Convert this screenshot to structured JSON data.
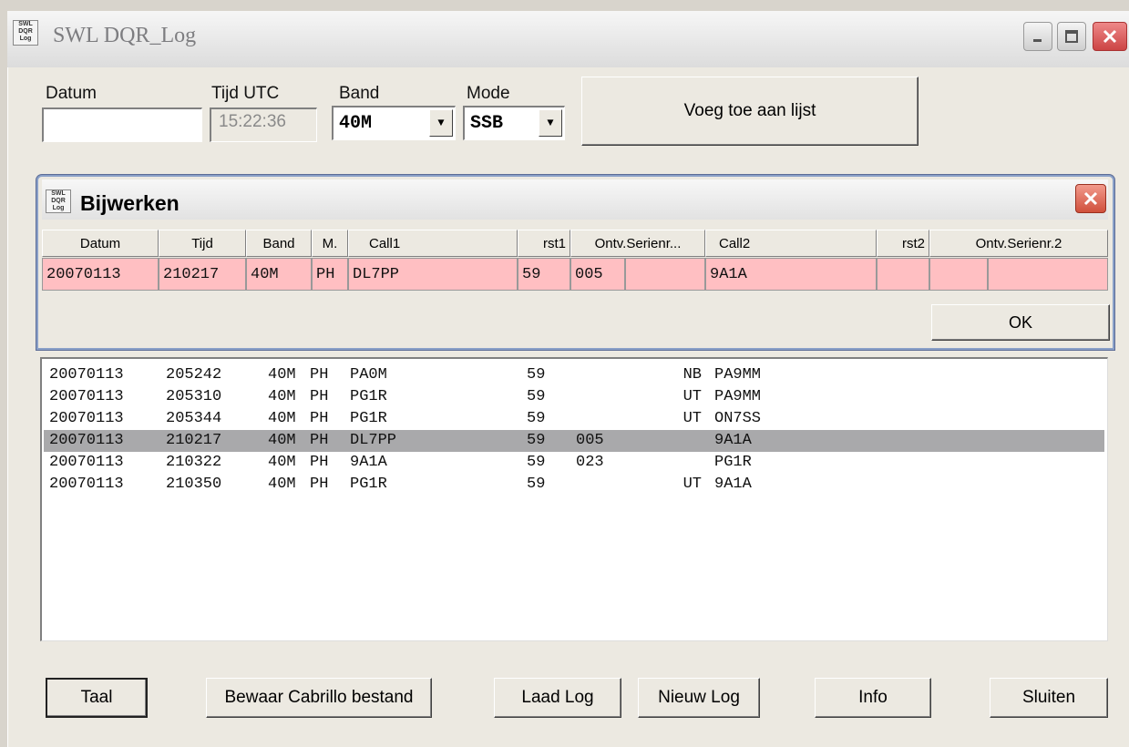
{
  "window": {
    "title": "SWL DQR_Log",
    "icon_text": "SWL DQR Log"
  },
  "form": {
    "datum_label": "Datum",
    "datum_value": "",
    "tijd_label": "Tijd UTC",
    "tijd_value": "15:22:36",
    "band_label": "Band",
    "band_value": "40M",
    "mode_label": "Mode",
    "mode_value": "SSB",
    "add_button": "Voeg toe aan lijst"
  },
  "dialog": {
    "title": "Bijwerken",
    "icon_text": "SWL DQR Log",
    "headers": [
      "Datum",
      "Tijd",
      "Band",
      "M.",
      "Call1",
      "rst1",
      "Ontv.Serienr...",
      "Call2",
      "rst2",
      "Ontv.Serienr.2"
    ],
    "row": {
      "datum": "20070113",
      "tijd": "210217",
      "band": "40M",
      "mode": "PH",
      "call1": "DL7PP",
      "rst1": "59",
      "serienr1": "005",
      "serienr1b": "",
      "call2": "9A1A",
      "rst2": "",
      "serienr2": "",
      "serienr2b": ""
    },
    "ok_button": "OK"
  },
  "log": [
    {
      "datum": "20070113",
      "tijd": "205242",
      "band": "40M",
      "mode": "PH",
      "call1": "PA0M",
      "rst": "59",
      "nr": "",
      "sect": "NB",
      "call2": "PA9MM",
      "selected": false
    },
    {
      "datum": "20070113",
      "tijd": "205310",
      "band": "40M",
      "mode": "PH",
      "call1": "PG1R",
      "rst": "59",
      "nr": "",
      "sect": "UT",
      "call2": "PA9MM",
      "selected": false
    },
    {
      "datum": "20070113",
      "tijd": "205344",
      "band": "40M",
      "mode": "PH",
      "call1": "PG1R",
      "rst": "59",
      "nr": "",
      "sect": "UT",
      "call2": "ON7SS",
      "selected": false
    },
    {
      "datum": "20070113",
      "tijd": "210217",
      "band": "40M",
      "mode": "PH",
      "call1": "DL7PP",
      "rst": "59",
      "nr": "005",
      "sect": "",
      "call2": "9A1A",
      "selected": true
    },
    {
      "datum": "20070113",
      "tijd": "210322",
      "band": "40M",
      "mode": "PH",
      "call1": "9A1A",
      "rst": "59",
      "nr": "023",
      "sect": "",
      "call2": "PG1R",
      "selected": false
    },
    {
      "datum": "20070113",
      "tijd": "210350",
      "band": "40M",
      "mode": "PH",
      "call1": "PG1R",
      "rst": "59",
      "nr": "",
      "sect": "UT",
      "call2": "9A1A",
      "selected": false
    }
  ],
  "buttons": {
    "taal": "Taal",
    "bewaar": "Bewaar Cabrillo bestand",
    "laad": "Laad Log",
    "nieuw": "Nieuw Log",
    "info": "Info",
    "sluiten": "Sluiten"
  },
  "icons": {
    "minimize": "minimize-icon",
    "maximize": "maximize-icon",
    "close": "close-icon",
    "dropdown": "chevron-down-icon"
  },
  "colors": {
    "edit_row_bg": "#ffbfc2",
    "selected_row_bg": "#a9a9ab",
    "close_red": "#d0503c"
  }
}
